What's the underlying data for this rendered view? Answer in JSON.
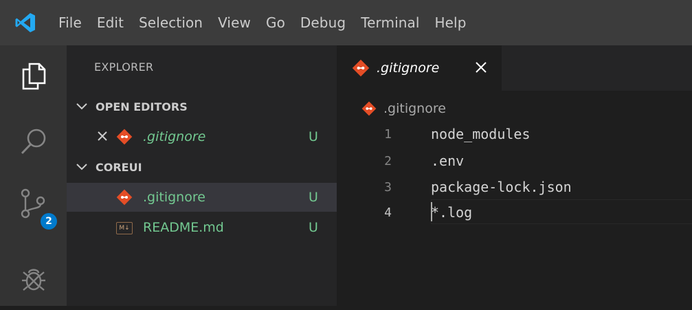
{
  "menu": [
    "File",
    "Edit",
    "Selection",
    "View",
    "Go",
    "Debug",
    "Terminal",
    "Help"
  ],
  "activity": {
    "scm_badge": "2"
  },
  "sidebar": {
    "title": "EXPLORER",
    "open_editors": {
      "header": "OPEN EDITORS",
      "items": [
        {
          "name": ".gitignore",
          "status": "U"
        }
      ]
    },
    "folder": {
      "header": "COREUI",
      "items": [
        {
          "name": ".gitignore",
          "status": "U"
        },
        {
          "name": "README.md",
          "status": "U",
          "icon_text": "M↓"
        }
      ]
    }
  },
  "tab": {
    "label": ".gitignore"
  },
  "breadcrumb": ".gitignore",
  "lines": [
    {
      "no": "1",
      "text": "node_modules"
    },
    {
      "no": "2",
      "text": ".env"
    },
    {
      "no": "3",
      "text": "package-lock.json"
    },
    {
      "no": "4",
      "text": "*.log"
    }
  ],
  "colors": {
    "accent": "#007acc",
    "git_icon": "#e44d26",
    "untracked": "#73c991"
  }
}
